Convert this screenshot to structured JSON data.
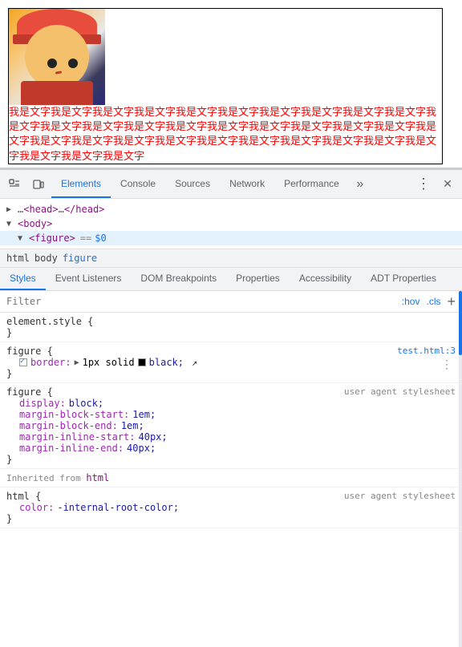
{
  "viewport": {
    "figure_text": "我是文字我是文字我是文字我是文字我是文字我是文字我是文字我是文字我是文字我是文字我是文字我是文字我是文字我是文字我是文字我是文字我是文字我是文字我是文字我是文字我是文字我是文字我是文字我是文字我是文字我是文字我是文字我是文字我是文字我是文字我是文字我是文字我是文字我是文字"
  },
  "devtools": {
    "tabs": [
      {
        "id": "elements",
        "label": "Elements",
        "active": true
      },
      {
        "id": "console",
        "label": "Console",
        "active": false
      },
      {
        "id": "sources",
        "label": "Sources",
        "active": false
      },
      {
        "id": "network",
        "label": "Network",
        "active": false
      },
      {
        "id": "performance",
        "label": "Performance",
        "active": false
      }
    ],
    "more_label": "»",
    "menu_label": "⋮",
    "close_label": "✕"
  },
  "html_tree": {
    "lines": [
      {
        "indent": 0,
        "arrow": "▶",
        "content": "<head>…</head>",
        "selected": false
      },
      {
        "indent": 0,
        "arrow": "▼",
        "content": "<body>",
        "selected": false
      },
      {
        "indent": 1,
        "arrow": "▼",
        "content": "<figure>",
        "selected": true,
        "extra": "== $0"
      }
    ]
  },
  "breadcrumb": {
    "items": [
      {
        "label": "html",
        "active": false
      },
      {
        "label": "body",
        "active": false
      },
      {
        "label": "figure",
        "active": true
      }
    ]
  },
  "sub_tabs": [
    {
      "label": "Styles",
      "active": true
    },
    {
      "label": "Event Listeners",
      "active": false
    },
    {
      "label": "DOM Breakpoints",
      "active": false
    },
    {
      "label": "Properties",
      "active": false
    },
    {
      "label": "Accessibility",
      "active": false
    },
    {
      "label": "ADT Properties",
      "active": false
    }
  ],
  "filter": {
    "placeholder": "Filter",
    "hov_label": ":hov",
    "cls_label": ".cls",
    "plus_label": "+"
  },
  "css_rules": [
    {
      "selector": "element.style {",
      "properties": [],
      "close": "}",
      "origin": null
    },
    {
      "selector": "figure {",
      "close": "}",
      "origin": "test.html:3",
      "properties": [
        {
          "checked": true,
          "name": "border:",
          "arrow": true,
          "swatch": true,
          "value": "1px solid",
          "color": "#000",
          "extra": "black;",
          "has_more": true
        }
      ]
    },
    {
      "selector": "figure {",
      "close": "}",
      "origin": "user agent stylesheet",
      "properties": [
        {
          "checked": false,
          "name": "display:",
          "value": "block;",
          "swatch": false
        },
        {
          "checked": false,
          "name": "margin-block-start:",
          "value": "1em;",
          "swatch": false
        },
        {
          "checked": false,
          "name": "margin-block-end:",
          "value": "1em;",
          "swatch": false
        },
        {
          "checked": false,
          "name": "margin-inline-start:",
          "value": "40px;",
          "swatch": false
        },
        {
          "checked": false,
          "name": "margin-inline-end:",
          "value": "40px;",
          "swatch": false
        }
      ]
    }
  ],
  "inherited": {
    "label": "Inherited from",
    "tag": "html",
    "rule": {
      "selector": "html {",
      "close": "}",
      "origin": "user agent stylesheet",
      "properties": [
        {
          "name": "color:",
          "value": "-internal-root-color;"
        }
      ]
    }
  }
}
